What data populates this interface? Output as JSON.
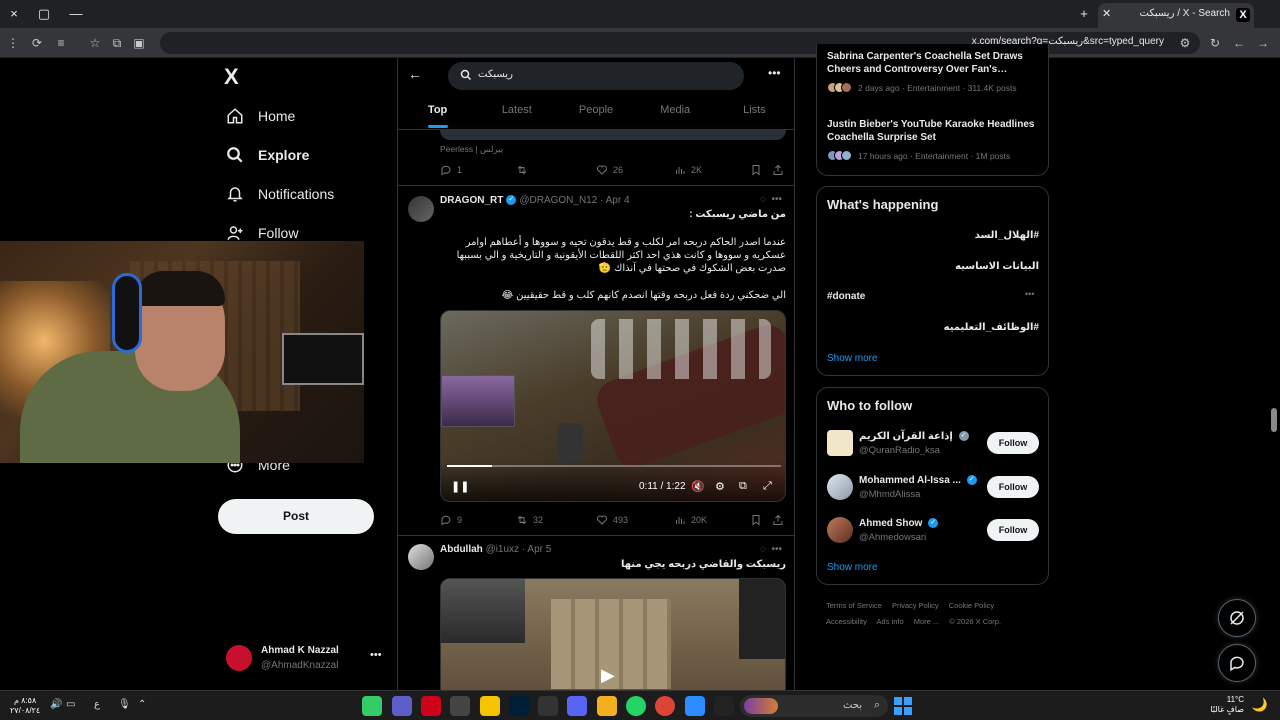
{
  "browser": {
    "tab_title": "ريسبكت / X - Search",
    "tab_favicon": "X",
    "url": "x.com/search?q=ريسبكت&src=typed_query",
    "titlebar_controls": [
      "×",
      "▢",
      "—",
      "+"
    ]
  },
  "nav": {
    "logo": "X",
    "items": [
      {
        "label": "Home",
        "icon": "home-icon"
      },
      {
        "label": "Explore",
        "icon": "search-icon"
      },
      {
        "label": "Notifications",
        "icon": "bell-icon"
      },
      {
        "label": "Follow",
        "icon": "person-add-icon"
      }
    ],
    "more_label": "More",
    "post_label": "Post",
    "account": {
      "name": "Ahmad K Nazzal",
      "handle": "@AhmadKnazzal"
    }
  },
  "search": {
    "query": "ريسبكت",
    "tabs": [
      "Top",
      "Latest",
      "People",
      "Media",
      "Lists"
    ],
    "active_tab": "Top"
  },
  "posts": [
    {
      "footer_text": "Peerless | بيرلس",
      "replies": "1",
      "reposts": "",
      "likes": "26",
      "views": "2K"
    },
    {
      "name": "DRAGON_RT",
      "handle": "@DRAGON_N12",
      "date": "Apr 4",
      "line1": "من ماضي ريسبكت :",
      "body": "عندما اصدر الحاكم دربحه امر لكلب و قط يدقون تحيه و سووها و أعطاهم اوامر عسكريه و سووها و كانت هذي احد اكثر اللقطات الأيقونية و التاريخية و الي بسببها صدرت بعض الشكوك في صحتها في آنذاك 🫡",
      "line3": "الي ضحكني ردة فعل دربحه وقتها انصدم كانهم كلب و قط حقيقيين 😂",
      "video_time": "0:11 / 1:22",
      "progress": 0.135,
      "replies": "9",
      "reposts": "32",
      "likes": "493",
      "views": "20K"
    },
    {
      "name": "Abdullah",
      "handle": "@i1uxz",
      "date": "Apr 5",
      "body": "ريسبكت والقاضي دربحه يجي منها"
    }
  ],
  "trends": [
    {
      "title": "Sabrina Carpenter's Coachella Set Draws Cheers and Controversy Over Fan's…",
      "meta": "2 days ago · Entertainment · 311.4K posts"
    },
    {
      "title": "Justin Bieber's YouTube Karaoke Headlines Coachella Surprise Set",
      "meta": "17 hours ago · Entertainment · 1M posts"
    }
  ],
  "happening": {
    "title": "What's happening",
    "items": [
      "#الهلال_السد",
      "البيانات الاساسيه",
      "#donate",
      "#الوظائف_التعليميه"
    ],
    "show_more": "Show more"
  },
  "who_to_follow": {
    "title": "Who to follow",
    "accounts": [
      {
        "name": "إذاعة القرآن الكريم",
        "handle": "@QuranRadio_ksa",
        "follow": "Follow"
      },
      {
        "name": "Mohammed Al-Issa ...",
        "handle": "@MhmdAlissa",
        "follow": "Follow"
      },
      {
        "name": "Ahmed Show",
        "handle": "@Ahmedowsari",
        "follow": "Follow"
      }
    ],
    "show_more": "Show more"
  },
  "footer": {
    "links": [
      "Terms of Service",
      "Privacy Policy",
      "Cookie Policy",
      "Accessibility",
      "Ads info",
      "More ...",
      "© 2026 X Corp."
    ]
  },
  "taskbar": {
    "time": "٨:٥٨ م",
    "date": "٢٧/٠٨/٢٤",
    "lang": "ع",
    "search_placeholder": "بحث",
    "weather_temp": "11°C",
    "weather_desc": "صافٍ غالبًا"
  },
  "colors": {
    "accent": "#1d9bf0",
    "background": "#000000",
    "border": "#2f3336",
    "muted": "#71767b"
  }
}
